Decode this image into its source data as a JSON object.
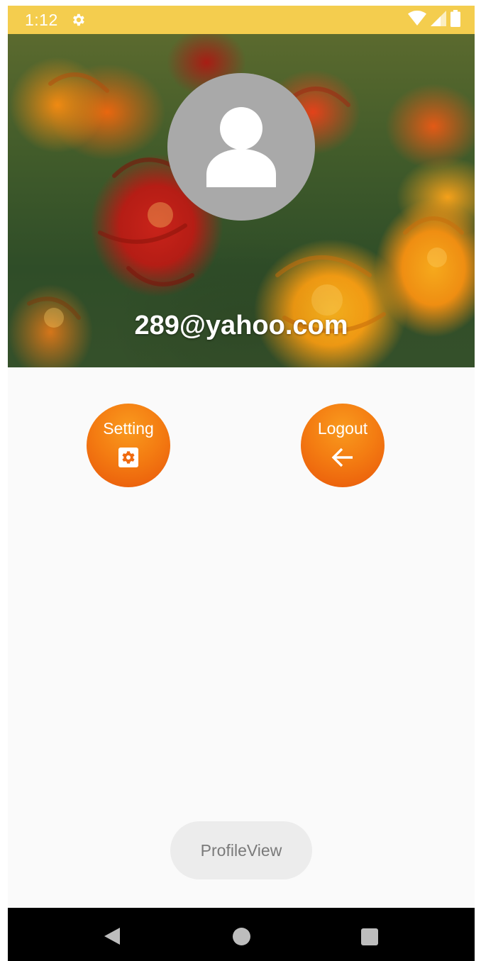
{
  "status_bar": {
    "time": "1:12",
    "background": "#f4cd4e",
    "icons": [
      "settings-gear-icon",
      "wifi-icon",
      "cellular-signal-icon",
      "battery-icon"
    ]
  },
  "profile": {
    "email": "289@yahoo.com",
    "avatar_icon": "person-icon",
    "avatar_color": "#a9a9a9"
  },
  "actions": {
    "setting": {
      "label": "Setting",
      "icon": "gear-icon"
    },
    "logout": {
      "label": "Logout",
      "icon": "arrow-left-icon"
    },
    "accent": "#f47d12"
  },
  "toast": {
    "text": "ProfileView"
  },
  "nav_bar": {
    "icons": [
      "back-triangle-icon",
      "home-circle-icon",
      "recents-square-icon"
    ]
  }
}
